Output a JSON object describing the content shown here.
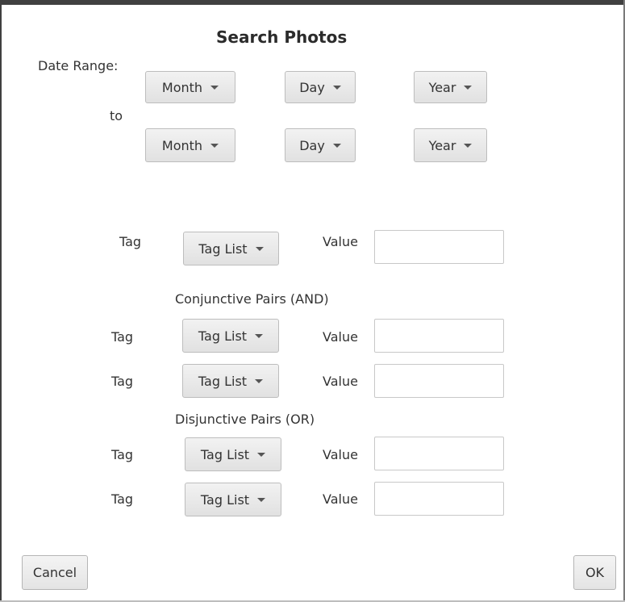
{
  "dialog": {
    "title": "Search Photos",
    "date_range_label": "Date Range:",
    "to_label": "to",
    "start": {
      "month": "Month",
      "day": "Day",
      "year": "Year"
    },
    "end": {
      "month": "Month",
      "day": "Day",
      "year": "Year"
    },
    "tag_label": "Tag",
    "value_label": "Value",
    "tag_list_label": "Tag List",
    "single_pair": {
      "value": ""
    },
    "conjunctive_heading": "Conjunctive Pairs (AND)",
    "conjunctive_pairs": [
      {
        "value": ""
      },
      {
        "value": ""
      }
    ],
    "disjunctive_heading": "Disjunctive Pairs (OR)",
    "disjunctive_pairs": [
      {
        "value": ""
      },
      {
        "value": ""
      }
    ],
    "cancel_label": "Cancel",
    "ok_label": "OK"
  }
}
